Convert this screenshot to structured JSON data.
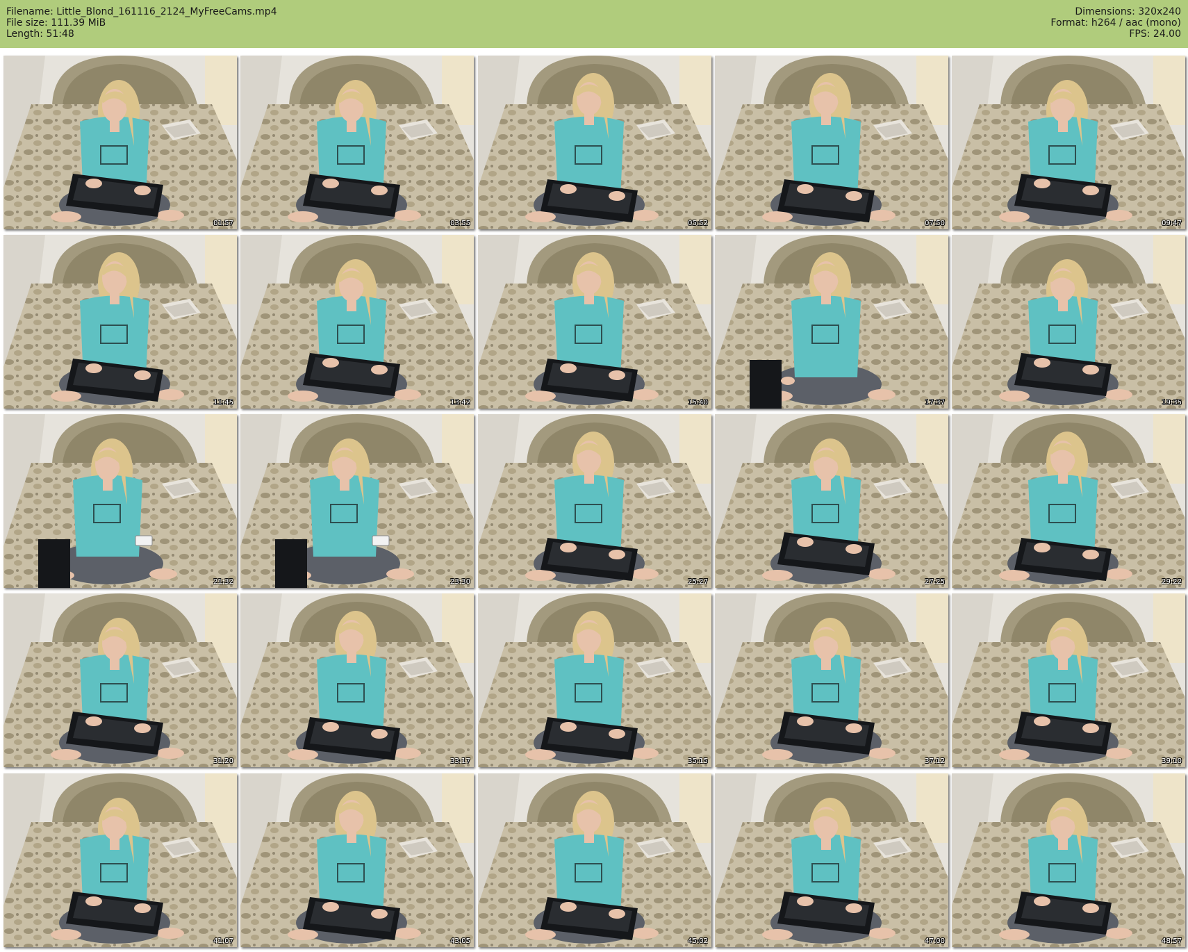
{
  "header": {
    "filename": "Filename: Little_Blond_161116_2124_MyFreeCams.mp4",
    "file_size": "File size: 111.39 MiB",
    "length": "Length: 51:48",
    "dimensions": "Dimensions: 320x240",
    "format": "Format: h264 / aac (mono)",
    "fps": "FPS: 24.00"
  },
  "thumbnails": [
    {
      "time": "01:57",
      "pose": "typing"
    },
    {
      "time": "03:55",
      "pose": "typing"
    },
    {
      "time": "05:52",
      "pose": "facing"
    },
    {
      "time": "07:50",
      "pose": "facing"
    },
    {
      "time": "09:47",
      "pose": "typing"
    },
    {
      "time": "11:45",
      "pose": "facing"
    },
    {
      "time": "13:42",
      "pose": "typing"
    },
    {
      "time": "15:40",
      "pose": "facing"
    },
    {
      "time": "17:37",
      "pose": "facing-side-keyboard"
    },
    {
      "time": "19:35",
      "pose": "typing"
    },
    {
      "time": "21:32",
      "pose": "phone"
    },
    {
      "time": "23:30",
      "pose": "phone"
    },
    {
      "time": "25:27",
      "pose": "facing"
    },
    {
      "time": "27:25",
      "pose": "typing"
    },
    {
      "time": "29:22",
      "pose": "facing"
    },
    {
      "time": "31:20",
      "pose": "typing"
    },
    {
      "time": "33:17",
      "pose": "facing"
    },
    {
      "time": "35:15",
      "pose": "facing"
    },
    {
      "time": "37:12",
      "pose": "typing"
    },
    {
      "time": "39:10",
      "pose": "typing"
    },
    {
      "time": "41:07",
      "pose": "typing"
    },
    {
      "time": "43:05",
      "pose": "facing"
    },
    {
      "time": "45:02",
      "pose": "facing"
    },
    {
      "time": "47:00",
      "pose": "typing"
    },
    {
      "time": "48:57",
      "pose": "typing"
    }
  ],
  "colors": {
    "header_bg": "#b0cc7c",
    "wall": "#e6e3dc",
    "headboard": "#a39a7e",
    "bedspread": "#c9bfa6",
    "shirt": "#5fc1c2",
    "hair": "#dcc48c",
    "skin": "#e7c2aa",
    "pants": "#5c6068",
    "keyboard": "#15171a"
  }
}
